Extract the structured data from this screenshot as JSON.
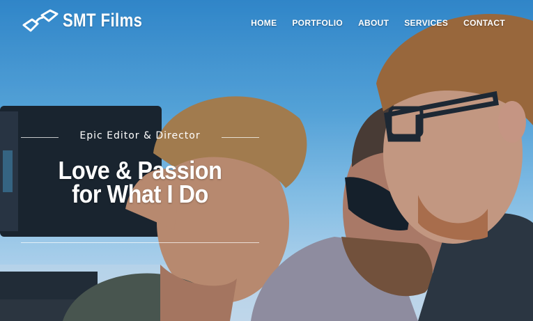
{
  "header": {
    "brand": "SMT Films",
    "logo_icon": "glasses-icon"
  },
  "nav": {
    "items": [
      {
        "label": "HOME"
      },
      {
        "label": "PORTFOLIO"
      },
      {
        "label": "ABOUT"
      },
      {
        "label": "SERVICES"
      },
      {
        "label": "CONTACT"
      }
    ]
  },
  "hero": {
    "tagline": "Epic Editor & Director",
    "headline_line1": "Love & Passion",
    "headline_line2": "for What I Do"
  },
  "colors": {
    "sky_top": "#2f86c9",
    "sky_bottom": "#d7e7f2",
    "text": "#ffffff"
  }
}
